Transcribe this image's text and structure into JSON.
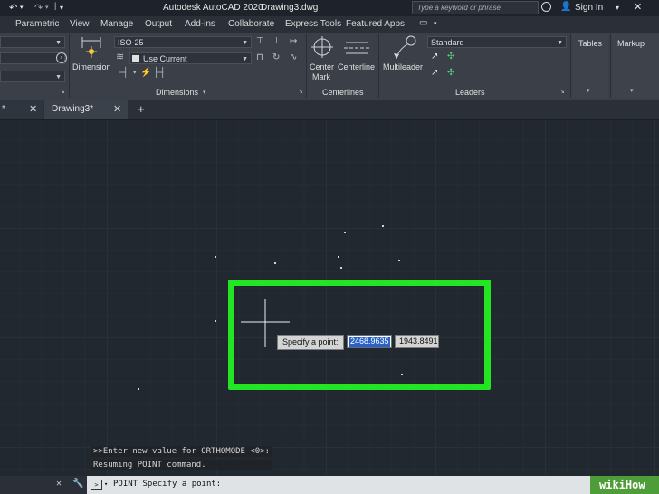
{
  "titlebar": {
    "app_title": "Autodesk AutoCAD 2020",
    "file_name": "Drawing3.dwg",
    "search_placeholder": "Type a keyword or phrase",
    "sign_in": "Sign In"
  },
  "menu": [
    "Parametric",
    "View",
    "Manage",
    "Output",
    "Add-ins",
    "Collaborate",
    "Express Tools",
    "Featured Apps"
  ],
  "ribbon": {
    "dimension_label": "Dimension",
    "dim_style": "ISO-25",
    "layer_value": "Use Current",
    "dimensions_panel": "Dimensions",
    "center_mark": [
      "Center",
      "Mark"
    ],
    "centerline": "Centerline",
    "centerlines_panel": "Centerlines",
    "multileader": "Multileader",
    "leader_style": "Standard",
    "leaders_panel": "Leaders",
    "tables": "Tables",
    "markup": "Markup"
  },
  "tabs": {
    "prev_tab_glyph": "*",
    "active_tab": "Drawing3*",
    "add_tab": "+"
  },
  "canvas": {
    "prompt_label": "Specify a point:",
    "x_value": "2468.9635",
    "y_value": "1943.8491",
    "highlight_color": "#22e622"
  },
  "command_history": [
    ">>Enter new value for ORTHOMODE <0>:",
    "Resuming POINT command."
  ],
  "command_line": {
    "text": "POINT Specify a point:"
  },
  "watermark": "wikiHow"
}
